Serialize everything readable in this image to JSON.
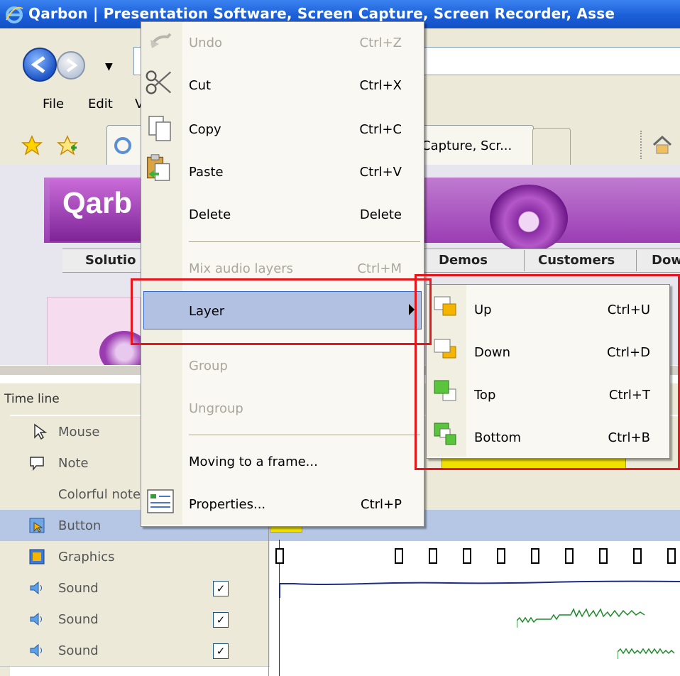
{
  "browser": {
    "title": "Qarbon | Presentation Software, Screen Capture, Screen Recorder, Asse",
    "menu": [
      "File",
      "Edit",
      "V"
    ],
    "tab_title": "Capture, Scr..."
  },
  "webpage": {
    "logo": "Qarb",
    "nav_tabs": [
      "Solutio",
      "Demos",
      "Customers",
      "Dow"
    ]
  },
  "timeline": {
    "header": "Time line",
    "rows": [
      {
        "label": "Mouse"
      },
      {
        "label": "Note"
      },
      {
        "label": "Colorful note"
      },
      {
        "label": "Button"
      },
      {
        "label": "Graphics"
      },
      {
        "label": "Sound",
        "checked": true
      },
      {
        "label": "Sound",
        "checked": true
      },
      {
        "label": "Sound",
        "checked": true
      }
    ]
  },
  "context_menu": {
    "items": [
      {
        "label": "Undo",
        "shortcut": "Ctrl+Z",
        "enabled": false,
        "icon": "undo-icon"
      },
      {
        "label": "Cut",
        "shortcut": "Ctrl+X",
        "enabled": true,
        "icon": "scissors-icon"
      },
      {
        "label": "Copy",
        "shortcut": "Ctrl+C",
        "enabled": true,
        "icon": "copy-icon"
      },
      {
        "label": "Paste",
        "shortcut": "Ctrl+V",
        "enabled": true,
        "icon": "paste-icon"
      },
      {
        "label": "Delete",
        "shortcut": "Delete",
        "enabled": true
      },
      {
        "label": "Mix audio layers",
        "shortcut": "Ctrl+M",
        "enabled": false
      },
      {
        "label": "Layer",
        "enabled": true,
        "highlighted": true
      },
      {
        "label": "Group",
        "enabled": false
      },
      {
        "label": "Ungroup",
        "enabled": false
      },
      {
        "label": "Moving to a frame...",
        "enabled": true
      },
      {
        "label": "Properties...",
        "shortcut": "Ctrl+P",
        "enabled": true,
        "icon": "properties-icon"
      }
    ]
  },
  "layer_submenu": {
    "items": [
      {
        "label": "Up",
        "shortcut": "Ctrl+U",
        "icon": "layer-up-icon"
      },
      {
        "label": "Down",
        "shortcut": "Ctrl+D",
        "icon": "layer-down-icon"
      },
      {
        "label": "Top",
        "shortcut": "Ctrl+T",
        "icon": "layer-top-icon"
      },
      {
        "label": "Bottom",
        "shortcut": "Ctrl+B",
        "icon": "layer-bottom-icon"
      }
    ]
  },
  "colors": {
    "highlight_box": "#e8161c",
    "menu_selection": "#b2c1e2",
    "titlebar": "#1b5fd8"
  }
}
